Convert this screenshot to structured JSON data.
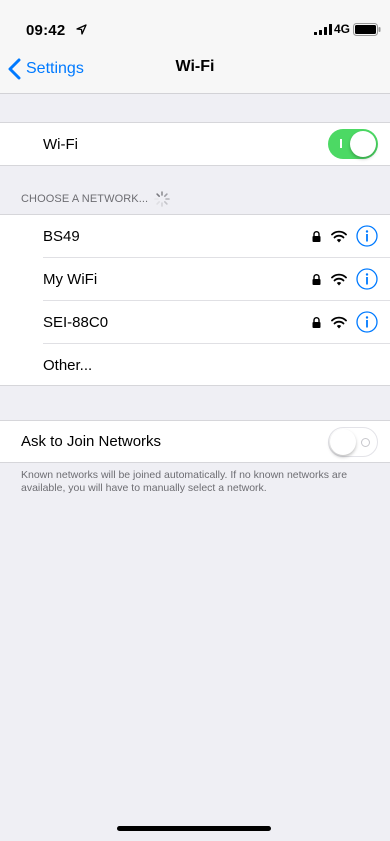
{
  "status_bar": {
    "time": "09:42",
    "network_type": "4G"
  },
  "nav": {
    "back_label": "Settings",
    "title": "Wi-Fi"
  },
  "wifi_toggle": {
    "label": "Wi-Fi",
    "on": true
  },
  "networks_section": {
    "header": "CHOOSE A NETWORK...",
    "items": [
      {
        "name": "BS49",
        "secured": true
      },
      {
        "name": "My WiFi",
        "secured": true
      },
      {
        "name": "SEI-88C0",
        "secured": true
      }
    ],
    "other_label": "Other..."
  },
  "ask_to_join": {
    "label": "Ask to Join Networks",
    "on": false,
    "footer": "Known networks will be joined automatically. If no known networks are available, you will have to manually select a network."
  },
  "colors": {
    "accent": "#007aff",
    "toggle_on": "#4cd964",
    "background": "#efeff4"
  },
  "icons": [
    "location-arrow-icon",
    "signal-icon",
    "battery-icon",
    "chevron-left-icon",
    "spinner-icon",
    "lock-icon",
    "wifi-icon",
    "info-icon"
  ]
}
